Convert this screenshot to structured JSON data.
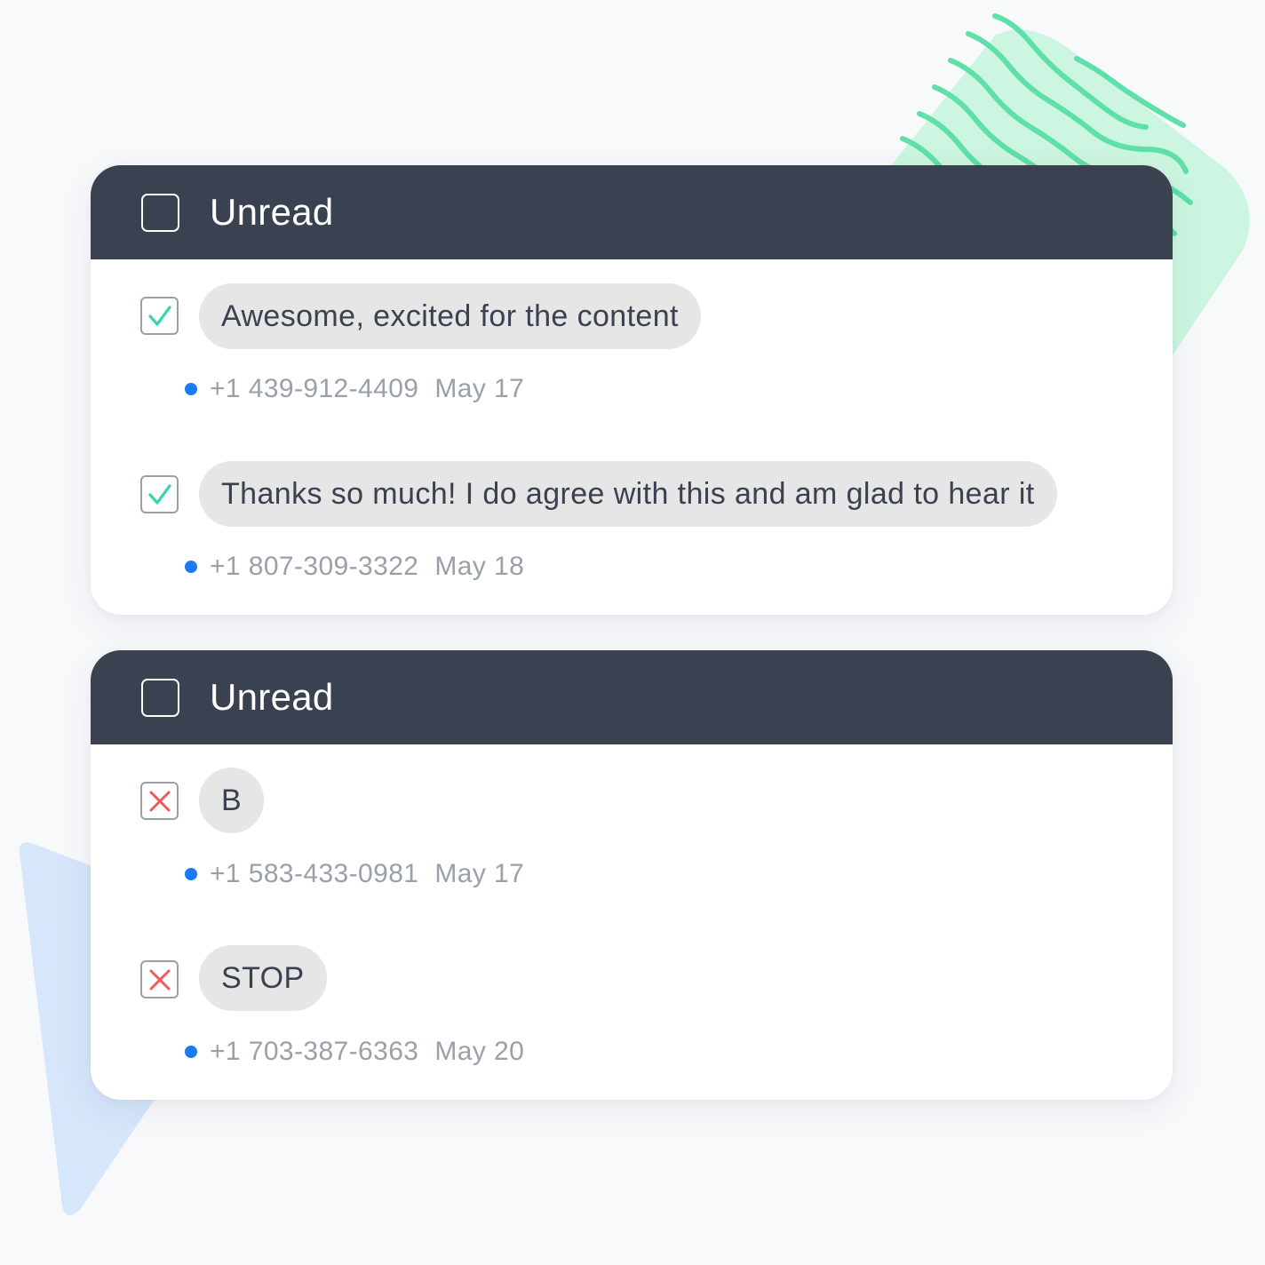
{
  "colors": {
    "header_bg": "#3a4150",
    "bubble_bg": "#e6e6e6",
    "check_accent": "#3ad3b0",
    "cross_accent": "#ee5a5a",
    "status_dot": "#1a7bf2",
    "meta_text": "#9aa0aa",
    "deco_green": "#a6f0cc",
    "deco_blue": "#d6e6fb"
  },
  "groups": [
    {
      "title": "Unread",
      "header_checked": false,
      "messages": [
        {
          "state": "checked",
          "state_icon": "checkmark-icon",
          "text": "Awesome, excited for the content",
          "phone": "+1 439-912-4409",
          "date": "May 17"
        },
        {
          "state": "checked",
          "state_icon": "checkmark-icon",
          "text": "Thanks so much! I do agree with this and am glad to hear it",
          "phone": "+1 807-309-3322",
          "date": "May 18"
        }
      ]
    },
    {
      "title": "Unread",
      "header_checked": false,
      "messages": [
        {
          "state": "rejected",
          "state_icon": "cross-icon",
          "text": "B",
          "phone": "+1 583-433-0981",
          "date": "May 17"
        },
        {
          "state": "rejected",
          "state_icon": "cross-icon",
          "text": "STOP",
          "phone": "+1 703-387-6363",
          "date": "May 20"
        }
      ]
    }
  ]
}
